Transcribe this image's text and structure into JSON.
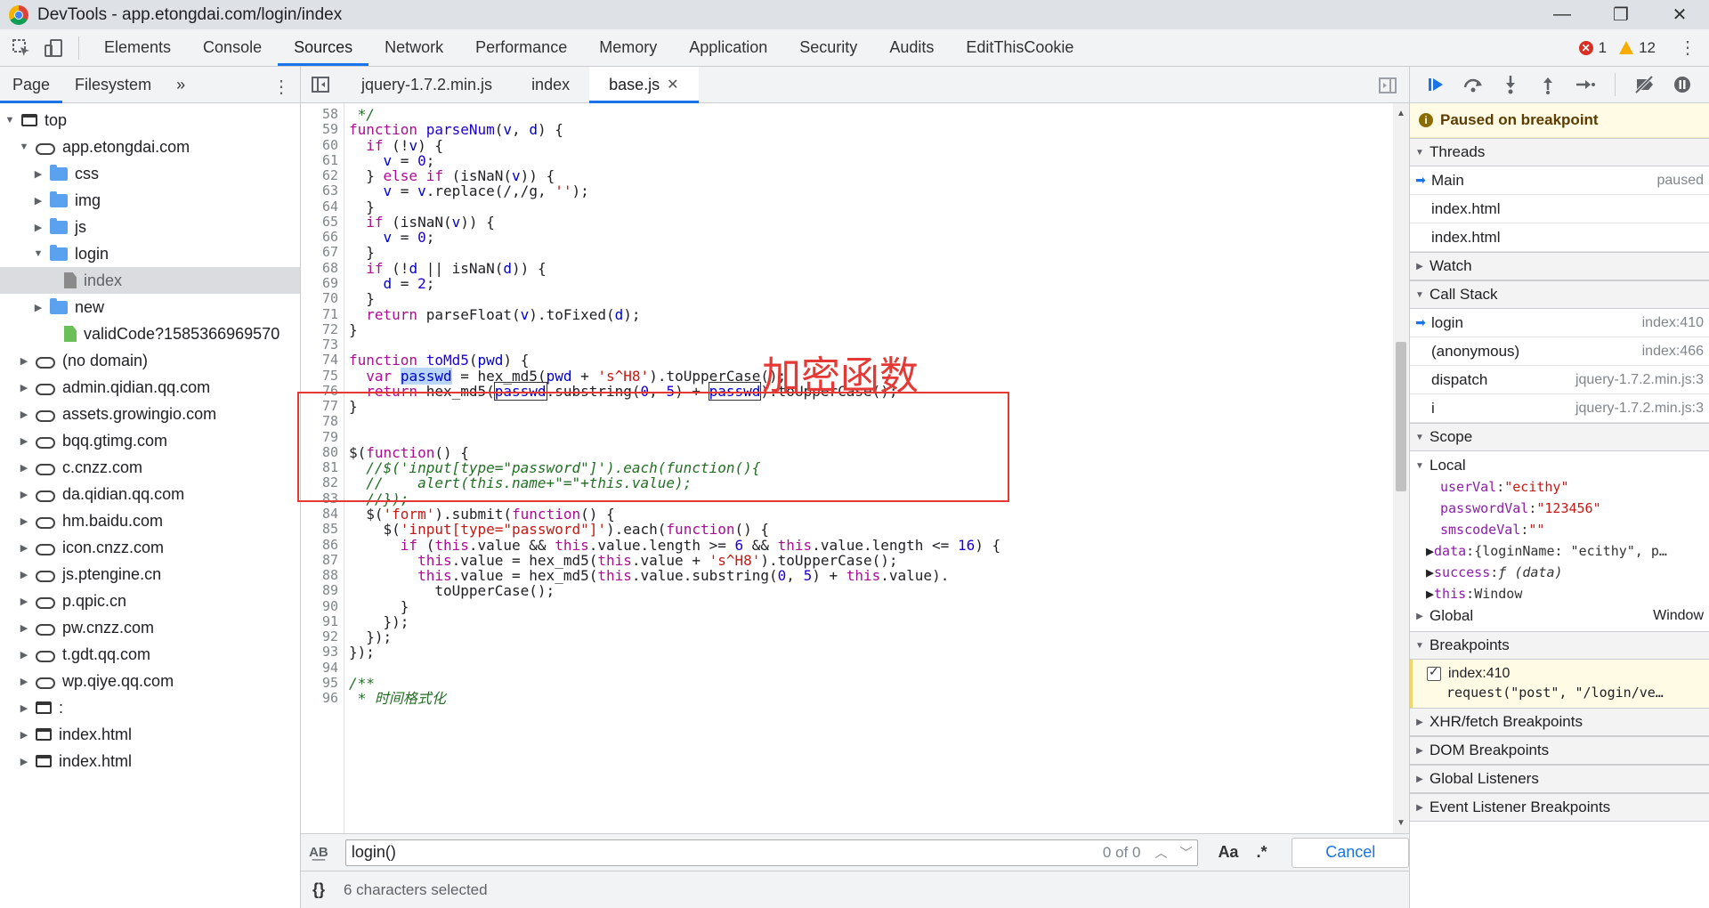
{
  "window": {
    "title": "DevTools - app.etongdai.com/login/index",
    "controls": [
      "—",
      "❐",
      "✕"
    ]
  },
  "main_tabs": [
    "Elements",
    "Console",
    "Sources",
    "Network",
    "Performance",
    "Memory",
    "Application",
    "Security",
    "Audits",
    "EditThisCookie"
  ],
  "issues": {
    "errors": "1",
    "warnings": "12"
  },
  "navigator": {
    "tabs": [
      "Page",
      "Filesystem"
    ],
    "more": "»",
    "tree": [
      {
        "label": "top",
        "depth": 0,
        "icon": "frame",
        "open": true
      },
      {
        "label": "app.etongdai.com",
        "depth": 1,
        "icon": "cloud",
        "open": true
      },
      {
        "label": "css",
        "depth": 2,
        "icon": "folder",
        "open": false
      },
      {
        "label": "img",
        "depth": 2,
        "icon": "folder",
        "open": false
      },
      {
        "label": "js",
        "depth": 2,
        "icon": "folder",
        "open": false
      },
      {
        "label": "login",
        "depth": 2,
        "icon": "folder",
        "open": true
      },
      {
        "label": "index",
        "depth": 3,
        "icon": "file",
        "selected": true
      },
      {
        "label": "new",
        "depth": 2,
        "icon": "folder",
        "open": false
      },
      {
        "label": "validCode?1585366969570",
        "depth": 3,
        "icon": "file-green"
      },
      {
        "label": "(no domain)",
        "depth": 1,
        "icon": "cloud",
        "open": false
      },
      {
        "label": "admin.qidian.qq.com",
        "depth": 1,
        "icon": "cloud",
        "open": false
      },
      {
        "label": "assets.growingio.com",
        "depth": 1,
        "icon": "cloud",
        "open": false
      },
      {
        "label": "bqq.gtimg.com",
        "depth": 1,
        "icon": "cloud",
        "open": false
      },
      {
        "label": "c.cnzz.com",
        "depth": 1,
        "icon": "cloud",
        "open": false
      },
      {
        "label": "da.qidian.qq.com",
        "depth": 1,
        "icon": "cloud",
        "open": false
      },
      {
        "label": "hm.baidu.com",
        "depth": 1,
        "icon": "cloud",
        "open": false
      },
      {
        "label": "icon.cnzz.com",
        "depth": 1,
        "icon": "cloud",
        "open": false
      },
      {
        "label": "js.ptengine.cn",
        "depth": 1,
        "icon": "cloud",
        "open": false
      },
      {
        "label": "p.qpic.cn",
        "depth": 1,
        "icon": "cloud",
        "open": false
      },
      {
        "label": "pw.cnzz.com",
        "depth": 1,
        "icon": "cloud",
        "open": false
      },
      {
        "label": "t.gdt.qq.com",
        "depth": 1,
        "icon": "cloud",
        "open": false
      },
      {
        "label": "wp.qiye.qq.com",
        "depth": 1,
        "icon": "cloud",
        "open": false
      },
      {
        "label": ":",
        "depth": 1,
        "icon": "frame",
        "open": false
      },
      {
        "label": "index.html",
        "depth": 1,
        "icon": "frame",
        "open": false
      },
      {
        "label": "index.html",
        "depth": 1,
        "icon": "frame",
        "open": false
      }
    ]
  },
  "editor": {
    "tabs": [
      {
        "label": "jquery-1.7.2.min.js",
        "active": false
      },
      {
        "label": "index",
        "active": false
      },
      {
        "label": "base.js",
        "active": true
      }
    ],
    "close_glyph": "✕",
    "first_line": 58,
    "lines": [
      " */",
      "function parseNum(v, d) {",
      "  if (!v) {",
      "    v = 0;",
      "  } else if (isNaN(v)) {",
      "    v = v.replace(/,/g, '');",
      "  }",
      "  if (isNaN(v)) {",
      "    v = 0;",
      "  }",
      "  if (!d || isNaN(d)) {",
      "    d = 2;",
      "  }",
      "  return parseFloat(v).toFixed(d);",
      "}",
      "",
      "function toMd5(pwd) {",
      "  var passwd = hex_md5(pwd + 's^H8').toUpperCase();",
      "  return hex_md5(passwd.substring(0, 5) + passwd).toUpperCase();",
      "}",
      "",
      "",
      "$(function() {",
      "  //$('input[type=\"password\"]').each(function(){",
      "  //    alert(this.name+\"=\"+this.value);",
      "  //});",
      "  $('form').submit(function() {",
      "    $('input[type=\"password\"]').each(function() {",
      "      if (this.value && this.value.length >= 6 && this.value.length <= 16) {",
      "        this.value = hex_md5(this.value + 's^H8').toUpperCase();",
      "        this.value = hex_md5(this.value.substring(0, 5) + this.value).",
      "          toUpperCase();",
      "      }",
      "    });",
      "  });",
      "});",
      "",
      "/**",
      " * 时间格式化"
    ],
    "annotation": "加密函数",
    "search": {
      "value": "login()",
      "count": "0 of 0",
      "match_case": "Aa",
      "regex": ".*",
      "cancel": "Cancel",
      "aa_icon": "A͟B"
    },
    "status": {
      "braces": "{}",
      "text": "6 characters selected"
    }
  },
  "debugger": {
    "paused_text": "Paused on breakpoint",
    "threads_title": "Threads",
    "threads": [
      {
        "name": "Main",
        "info": "paused",
        "current": true
      },
      {
        "name": "index.html",
        "info": ""
      },
      {
        "name": "index.html",
        "info": ""
      }
    ],
    "watch_title": "Watch",
    "callstack_title": "Call Stack",
    "callstack": [
      {
        "name": "login",
        "info": "index:410",
        "current": true
      },
      {
        "name": "(anonymous)",
        "info": "index:466"
      },
      {
        "name": "dispatch",
        "info": "jquery-1.7.2.min.js:3"
      },
      {
        "name": "i",
        "info": "jquery-1.7.2.min.js:3"
      }
    ],
    "scope_title": "Scope",
    "local_title": "Local",
    "scope_vars": [
      {
        "key": "userVal",
        "value": "\"ecithy\""
      },
      {
        "key": "passwordVal",
        "value": "\"123456\""
      },
      {
        "key": "smscodeVal",
        "value": "\"\""
      },
      {
        "key": "data",
        "value": "{loginName: \"ecithy\", p…",
        "expandable": true
      },
      {
        "key": "success",
        "value": "ƒ (data)",
        "expandable": true
      },
      {
        "key": "this",
        "value": "Window",
        "expandable": true
      }
    ],
    "global_title": "Global",
    "global_value": "Window",
    "breakpoints_title": "Breakpoints",
    "breakpoint": {
      "location": "index:410",
      "code": "request(\"post\", \"/login/ve…"
    },
    "more_sections": [
      "XHR/fetch Breakpoints",
      "DOM Breakpoints",
      "Global Listeners",
      "Event Listener Breakpoints"
    ]
  },
  "colors": {
    "accent": "#1a73e8",
    "error": "#d93025",
    "warning": "#f9ab00",
    "annotation": "#e53935",
    "paused_bg": "#fffbe5"
  }
}
